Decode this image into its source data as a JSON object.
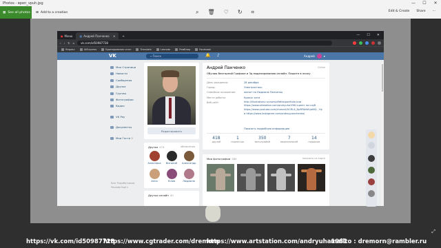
{
  "window": {
    "title": "Photos - вреп_vpuh.jpg",
    "min": "—",
    "max": "☐",
    "close": "✕"
  },
  "toolbar": {
    "all_photos": "See all photos",
    "add_creation": "Add to a creation",
    "edit_create": "Edit & Create",
    "share": "Share",
    "more": "···"
  },
  "browser": {
    "tab_menu": "Меню",
    "tab_title": "Андрей Панченко",
    "new_tab": "+",
    "url": "vk.com/id50987728",
    "bookmarks": [
      "Яндекс",
      "AliExpress",
      "Бронирование отел",
      "Translate",
      "Lamoda",
      "Рамблер",
      "Facebook"
    ]
  },
  "vk": {
    "logo": "VK",
    "search": "Поиск",
    "user": "Андрей",
    "menu": [
      "Моя Страница",
      "Новости",
      "Сообщения",
      "Друзья",
      "Группы",
      "Фотографии",
      "Видео"
    ],
    "menu2": [
      "VK Pay"
    ],
    "menu3": [
      "Документы"
    ],
    "menu4": [
      "Мои Гости"
    ],
    "menu4_badge": "5",
    "footer": "Блог  Разработчикам  Реклама  Ещё ▾",
    "edit": "Редактировать",
    "friends": {
      "title": "Друзья",
      "count": "474",
      "updates": "обновления",
      "names": [
        "Анжелика",
        "Виталий",
        "Александр",
        "Анна",
        "Юлия",
        "Людмила"
      ]
    },
    "friends_online": {
      "title": "Друзья онлайн",
      "count": "40"
    },
    "profile": {
      "name": "Андрей Панченко",
      "online": "Online",
      "status": "Обучаю Векторной Графике и 3д моделированию онлайн. Пишите в личку",
      "rows": [
        {
          "k": "День рождения:",
          "v": "28 декабря"
        },
        {
          "k": "Город:",
          "v": "Электросталь"
        },
        {
          "k": "Семейное положение:",
          "v": "женат на Людмиле Панченко"
        },
        {
          "k": "Место работы:",
          "v": "Крокус сити"
        },
        {
          "k": "Веб-сайт:",
          "v": "http://illustrators.ru/users/dfdfdx/portfolio или https://www.artstation.com/andryuha1981 кинет на клуб https://www.youtube.com/channel/UCRL4_DpRFAkWLjaiNQ , Ну и https://www.instagram.com/andrey.panchenko/"
        }
      ],
      "more": "Показать подробную информацию",
      "counts": [
        {
          "n": "418",
          "l": "друзей"
        },
        {
          "n": "1",
          "l": "подписчик"
        },
        {
          "n": "350",
          "l": "фотографий"
        },
        {
          "n": "7",
          "l": "видеозаписей"
        },
        {
          "n": "14",
          "l": "подарков"
        }
      ]
    },
    "photos": {
      "title": "Мои фотографии",
      "count": "280",
      "map": "показать на карте"
    }
  },
  "footer": {
    "vk": "https://vk.com/id50987728",
    "cg": "https://www.cgtrader.com/dremorn",
    "as": "https://www.artstation.com/andryuha1981",
    "mail": "mailto : dremorn@rambler.ru"
  },
  "colors": {
    "vk_blue": "#4a76a8",
    "photos_green": "#3b8a2b",
    "link": "#2a5885"
  }
}
